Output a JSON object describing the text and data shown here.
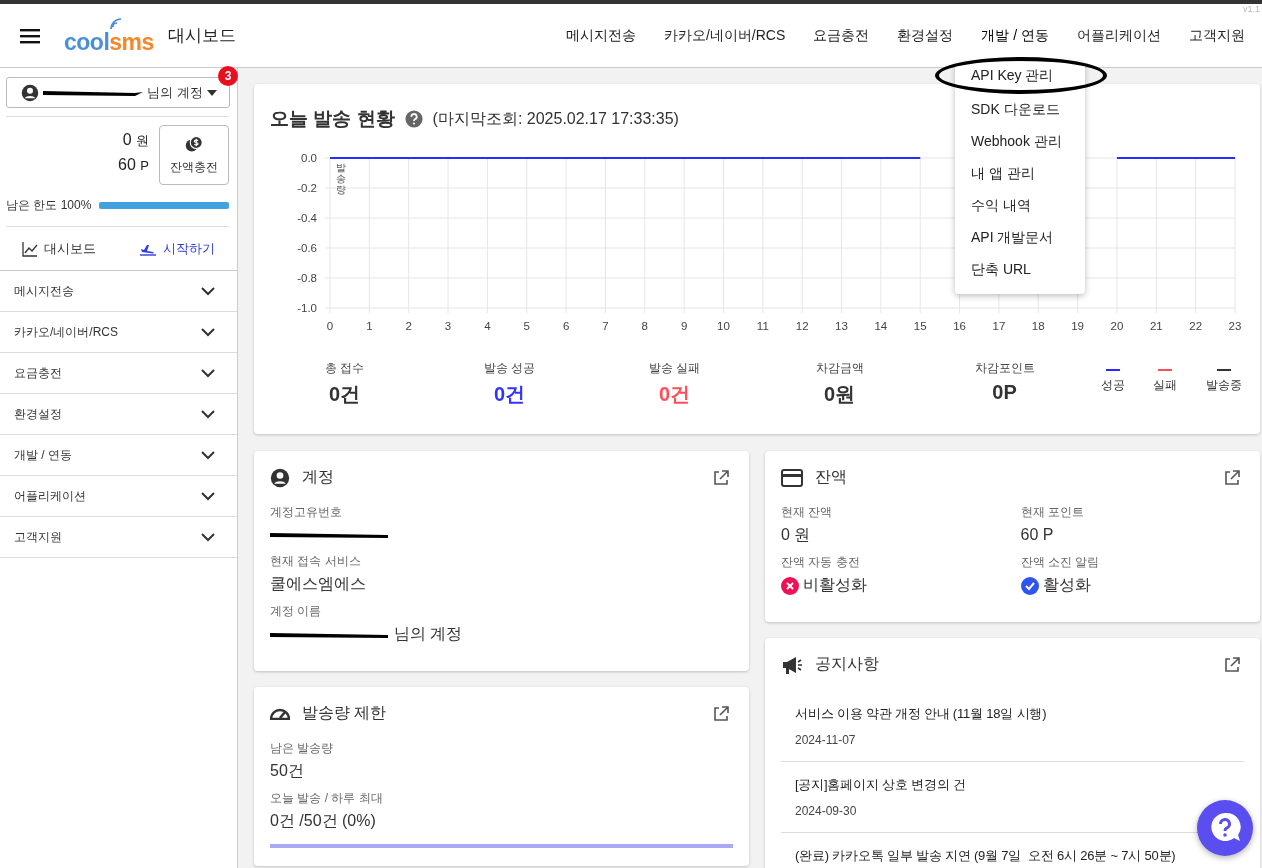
{
  "header": {
    "brand": [
      {
        "text": "cool",
        "color": "#4a8fdc"
      },
      {
        "text": "sms",
        "color": "#f5862a"
      }
    ],
    "title": "대시보드",
    "version": "v1.1",
    "nav": [
      {
        "label": "메시지전송",
        "open": false
      },
      {
        "label": "카카오/네이버/RCS",
        "open": false
      },
      {
        "label": "요금충전",
        "open": false
      },
      {
        "label": "환경설정",
        "open": false
      },
      {
        "label": "개발 / 연동",
        "open": true
      },
      {
        "label": "어플리케이션",
        "open": false
      },
      {
        "label": "고객지원",
        "open": false
      }
    ]
  },
  "dev_menu": {
    "items": [
      {
        "label": "API Key 관리",
        "circled": true
      },
      {
        "label": "SDK 다운로드",
        "circled": false
      },
      {
        "label": "Webhook 관리",
        "circled": false
      },
      {
        "label": "내 앱 관리",
        "circled": false
      },
      {
        "label": "수익 내역",
        "circled": false
      },
      {
        "label": "API 개발문서",
        "circled": false
      },
      {
        "label": "단축 URL",
        "circled": false
      }
    ]
  },
  "sidebar": {
    "account": {
      "label": "님의 계정",
      "redacted": true,
      "badge": "3"
    },
    "balance": "0",
    "balance_unit": "원",
    "points": "60",
    "points_unit": "P",
    "charge_button": "잔액충전",
    "limit": {
      "label": "남은 한도 100%",
      "level": 1
    },
    "tabs": [
      {
        "label": "대시보드",
        "kind": "chart",
        "selected": false
      },
      {
        "label": "시작하기",
        "kind": "plane",
        "selected": true
      }
    ],
    "menu": [
      {
        "label": "메시지전송",
        "expanded": false
      },
      {
        "label": "카카오/네이버/RCS",
        "expanded": false
      },
      {
        "label": "요금충전",
        "expanded": false
      },
      {
        "label": "환경설정",
        "expanded": false
      },
      {
        "label": "개발 / 연동",
        "expanded": false
      },
      {
        "label": "어플리케이션",
        "expanded": false
      },
      {
        "label": "고객지원",
        "expanded": false
      }
    ]
  },
  "today": {
    "title": "오늘 발송 현황",
    "last_checked": "(마지막조회: 2025.02.17 17:33:35)",
    "chart_data": {
      "type": "line",
      "ylabel": "발송량",
      "xlim": [
        0,
        23
      ],
      "grid": true,
      "x": [
        0,
        1,
        2,
        3,
        4,
        5,
        6,
        7,
        8,
        9,
        10,
        11,
        12,
        13,
        14,
        15,
        16,
        17,
        18,
        19,
        20,
        21,
        22,
        23
      ],
      "xticks": [
        0,
        1,
        2,
        3,
        4,
        5,
        6,
        7,
        8,
        9,
        10,
        11,
        12,
        13,
        14,
        15,
        16,
        17,
        18,
        19,
        20,
        21,
        22,
        23
      ],
      "ylim": [
        -1,
        0
      ],
      "yticks": [
        {
          "value": 0,
          "label": "0.0"
        },
        {
          "value": -0.2,
          "label": "-0.2"
        },
        {
          "value": -0.4,
          "label": "-0.4"
        },
        {
          "value": -0.6,
          "label": "-0.6"
        },
        {
          "value": -0.8,
          "label": "-0.8"
        },
        {
          "value": -1,
          "label": "-1.0"
        }
      ],
      "series": [
        {
          "name": "성공",
          "color": "#2b2bff",
          "values": [
            0,
            0,
            0,
            0,
            0,
            0,
            0,
            0,
            0,
            0,
            0,
            0,
            0,
            0,
            0,
            0,
            null,
            null,
            null,
            null,
            0,
            0,
            0,
            0
          ]
        }
      ]
    },
    "legend": [
      {
        "label": "실패",
        "color": "#ff4d5a"
      },
      {
        "label": "발송중",
        "color": "#333333"
      }
    ],
    "stats": [
      {
        "label": "총 접수",
        "value": "0건",
        "color": "#333333"
      },
      {
        "label": "발송 성공",
        "value": "0건",
        "color": "#3333ff"
      },
      {
        "label": "발송 실패",
        "value": "0건",
        "color": "#ff4d5a"
      },
      {
        "label": "차감금액",
        "value": "0원",
        "color": "#333333"
      },
      {
        "label": "차감포인트",
        "value": "0P",
        "color": "#333333"
      }
    ]
  },
  "account_card": {
    "title": "계정",
    "fields": [
      {
        "label": "계정고유번호",
        "redacted": true
      },
      {
        "label": "현재 접속 서비스",
        "value": "쿨에스엠에스",
        "redacted": false
      },
      {
        "label": "계정 이름",
        "value": "님의 계정",
        "redacted": true
      }
    ]
  },
  "balance_card": {
    "title": "잔액",
    "fields": [
      {
        "label": "현재 잔액",
        "value": "0 원",
        "kind": "text"
      },
      {
        "label": "현재 포인트",
        "value": "60 P",
        "kind": "text"
      },
      {
        "label": "잔액 자동 충전",
        "value": "비활성화",
        "kind": "status",
        "on": false
      },
      {
        "label": "잔액 소진 알림",
        "value": "활성화",
        "kind": "status",
        "on": true
      }
    ]
  },
  "limit_card": {
    "title": "발송량 제한",
    "fields": [
      {
        "label": "남은 발송량",
        "value": "50건"
      },
      {
        "label": "오늘 발송 / 하루 최대",
        "value": "0건 /50건 (0%)"
      }
    ],
    "level": 0
  },
  "notice_card": {
    "title": "공지사항",
    "items": [
      {
        "title": "서비스 이용 약관 개정 안내 (11월 18일 시행)",
        "date": "2024-11-07"
      },
      {
        "title": "[공지]홈페이지 상호 변경의 건",
        "date": "2024-09-30"
      },
      {
        "title": "(완료) 카카오톡 일부 발송 지연 (9월 7일  오전 6시 26분 ~ 7시 50분)"
      }
    ]
  }
}
